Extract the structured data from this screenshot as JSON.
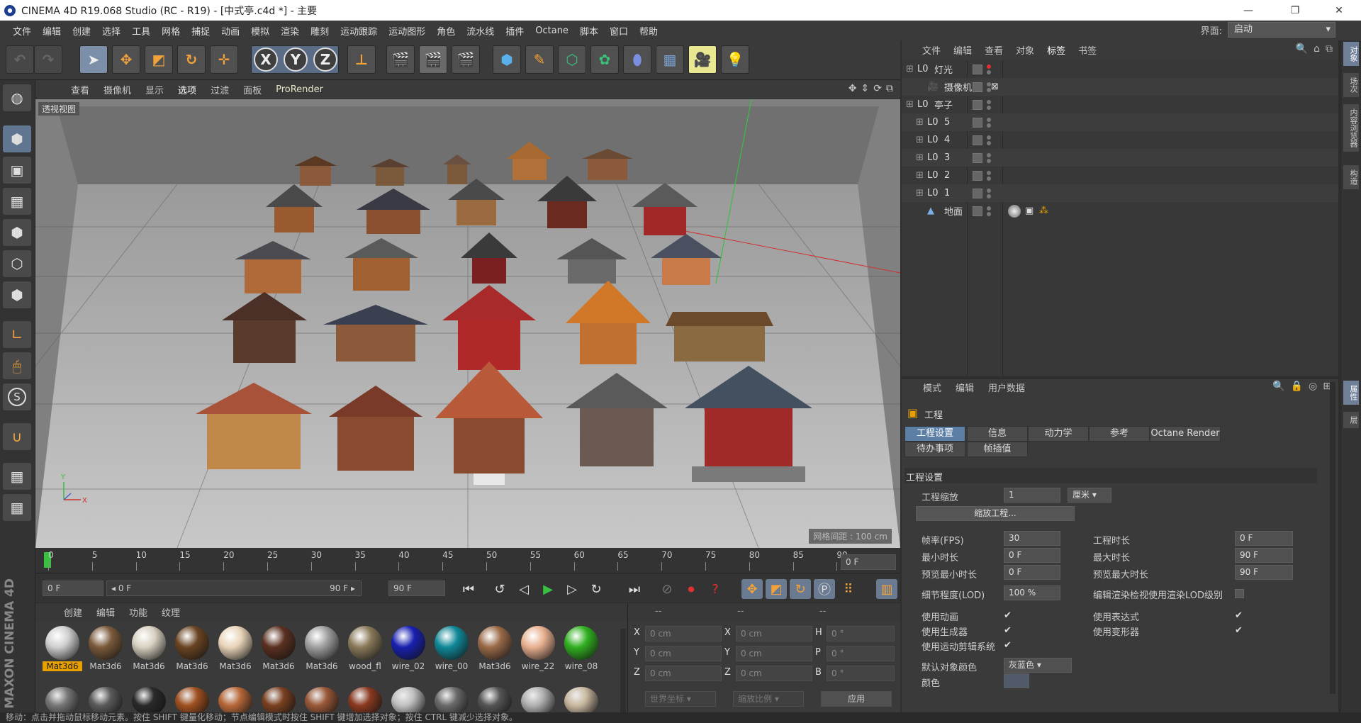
{
  "window": {
    "title": "CINEMA 4D R19.068 Studio (RC - R19) - [中式亭.c4d *] - 主要",
    "min": "—",
    "max": "❐",
    "close": "✕"
  },
  "menu": [
    "文件",
    "编辑",
    "创建",
    "选择",
    "工具",
    "网格",
    "捕捉",
    "动画",
    "模拟",
    "渲染",
    "雕刻",
    "运动跟踪",
    "运动图形",
    "角色",
    "流水线",
    "插件",
    "Octane",
    "脚本",
    "窗口",
    "帮助"
  ],
  "interface": {
    "label": "界面:",
    "value": "启动"
  },
  "toolbar": {
    "x": "X",
    "y": "Y",
    "z": "Z"
  },
  "viewport": {
    "menu": [
      "查看",
      "摄像机",
      "显示",
      "选项",
      "过滤",
      "面板",
      "ProRender"
    ],
    "label": "透视视图",
    "grid": "网格间距 : 100 cm"
  },
  "timeline": {
    "ticks": [
      "0",
      "5",
      "10",
      "15",
      "20",
      "25",
      "30",
      "35",
      "40",
      "45",
      "50",
      "55",
      "60",
      "65",
      "70",
      "75",
      "80",
      "85",
      "90"
    ],
    "current": "0 F"
  },
  "transport": {
    "start": "0 F",
    "slider_left": "0 F",
    "slider_right": "90 F",
    "end": "90 F"
  },
  "materials": {
    "menu": [
      "创建",
      "编辑",
      "功能",
      "纹理"
    ],
    "row1": [
      {
        "label": "Mat3d6",
        "color": "#cfcfcf"
      },
      {
        "label": "Mat3d6",
        "color": "#7a5a3a"
      },
      {
        "label": "Mat3d6",
        "color": "#d8d0c0"
      },
      {
        "label": "Mat3d6",
        "color": "#6a4422"
      },
      {
        "label": "Mat3d6",
        "color": "#e8d4b8"
      },
      {
        "label": "Mat3d6",
        "color": "#5a3020"
      },
      {
        "label": "Mat3d6",
        "color": "#a0a0a0"
      },
      {
        "label": "wood_fl",
        "color": "#8a7a5a"
      },
      {
        "label": "wire_02",
        "color": "#1820b0"
      },
      {
        "label": "wire_00",
        "color": "#108898"
      },
      {
        "label": "Mat3d6",
        "color": "#9a6a48"
      },
      {
        "label": "wire_22",
        "color": "#e8b090"
      },
      {
        "label": "wire_08",
        "color": "#30b020"
      }
    ],
    "row2": [
      "#777",
      "#5a5a5a",
      "#2a2a2a",
      "#a05020",
      "#b86838",
      "#7a4020",
      "#9a5838",
      "#8a3a20",
      "#c0c0c0",
      "#6a6a6a",
      "#555",
      "#b0b0b0",
      "#c8b8a0"
    ]
  },
  "coords": {
    "x1": "0 cm",
    "y1": "0 cm",
    "z1": "0 cm",
    "x2": "0 cm",
    "y2": "0 cm",
    "z2": "0 cm",
    "h": "0 °",
    "p": "0 °",
    "b": "0 °",
    "dash": "--",
    "mode1": "世界坐标",
    "mode2": "缩放比例",
    "apply": "应用"
  },
  "objects": {
    "menu": [
      "文件",
      "编辑",
      "查看",
      "对象",
      "标签",
      "书签"
    ],
    "items": [
      {
        "name": "灯光",
        "indent": 0
      },
      {
        "name": "摄像机",
        "indent": 1
      },
      {
        "name": "亭子",
        "indent": 0
      },
      {
        "name": "5",
        "indent": 1
      },
      {
        "name": "4",
        "indent": 1
      },
      {
        "name": "3",
        "indent": 1
      },
      {
        "name": "2",
        "indent": 1
      },
      {
        "name": "1",
        "indent": 1
      },
      {
        "name": "地面",
        "indent": 1
      }
    ]
  },
  "attributes": {
    "menu": [
      "模式",
      "编辑",
      "用户数据"
    ],
    "object": "工程",
    "tabs": [
      "工程设置",
      "信息",
      "动力学",
      "参考",
      "Octane Render",
      "待办事项",
      "帧插值"
    ],
    "section": "工程设置",
    "scale_label": "工程缩放",
    "scale_value": "1",
    "scale_unit": "厘米",
    "scale_btn": "缩放工程...",
    "fps_label": "帧率(FPS)",
    "fps": "30",
    "len_label": "工程时长",
    "len": "0 F",
    "min_label": "最小时长",
    "min": "0 F",
    "max_label": "最大时长",
    "max": "90 F",
    "pmin_label": "预览最小时长",
    "pmin": "0 F",
    "pmax_label": "预览最大时长",
    "pmax": "90 F",
    "lod_label": "细节程度(LOD)",
    "lod": "100 %",
    "lod_render": "编辑渲染检视使用渲染LOD级别",
    "use_anim": "使用动画",
    "use_expr": "使用表达式",
    "use_gen": "使用生成器",
    "use_deform": "使用变形器",
    "use_motion": "使用运动剪辑系统",
    "default_color_label": "默认对象颜色",
    "default_color": "灰蓝色",
    "color_label": "颜色"
  },
  "status": "移动：点击并拖动鼠标移动元素。按住 SHIFT 键量化移动；节点编辑模式时按住 SHIFT 键增加选择对象；按住 CTRL 键减少选择对象。",
  "right_tabs": [
    "对象",
    "场次",
    "内容浏览器",
    "构造"
  ],
  "right_tabs2": [
    "属性",
    "层"
  ]
}
